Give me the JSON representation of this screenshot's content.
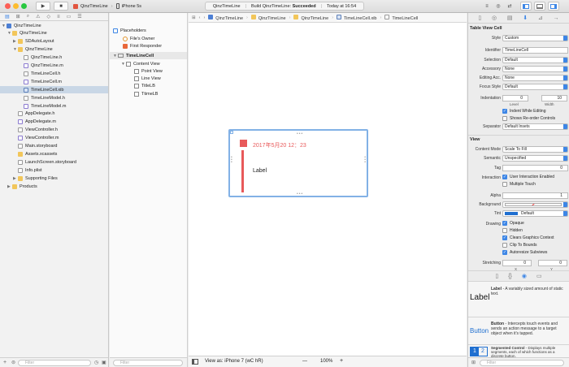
{
  "toolbar": {
    "scheme": "QinzTimeLine",
    "device": "iPhone 5s",
    "activity_project": "QinzTimeLine",
    "activity_status_prefix": "Build QinzTimeLine: ",
    "activity_status": "Succeeded",
    "activity_time": "Today at 16:54"
  },
  "navigator": {
    "rows": [
      {
        "label": "QinzTimeLine",
        "icon": "project",
        "indent": 0,
        "open": true
      },
      {
        "label": "QinzTimeLine",
        "icon": "folder",
        "indent": 1,
        "open": true
      },
      {
        "label": "SDAutoLayout",
        "icon": "folder",
        "indent": 2,
        "open": false
      },
      {
        "label": "QinzTimeLine",
        "icon": "folder",
        "indent": 2,
        "open": true
      },
      {
        "label": "QinzTimeLine.h",
        "icon": "h",
        "indent": 3
      },
      {
        "label": "QinzTimeLine.m",
        "icon": "m",
        "indent": 3
      },
      {
        "label": "TimeLineCell.h",
        "icon": "h",
        "indent": 3
      },
      {
        "label": "TimeLineCell.m",
        "icon": "m",
        "indent": 3
      },
      {
        "label": "TimeLineCell.xib",
        "icon": "xib",
        "indent": 3,
        "selected": true
      },
      {
        "label": "TimeLineModel.h",
        "icon": "h",
        "indent": 3
      },
      {
        "label": "TimeLineModel.m",
        "icon": "m",
        "indent": 3
      },
      {
        "label": "AppDelegate.h",
        "icon": "h",
        "indent": 2
      },
      {
        "label": "AppDelegate.m",
        "icon": "m",
        "indent": 2
      },
      {
        "label": "ViewController.h",
        "icon": "h",
        "indent": 2
      },
      {
        "label": "ViewController.m",
        "icon": "m",
        "indent": 2
      },
      {
        "label": "Main.storyboard",
        "icon": "storyboard",
        "indent": 2
      },
      {
        "label": "Assets.xcassets",
        "icon": "assets",
        "indent": 2
      },
      {
        "label": "LaunchScreen.storyboard",
        "icon": "storyboard",
        "indent": 2
      },
      {
        "label": "Info.plist",
        "icon": "plist",
        "indent": 2
      },
      {
        "label": "Supporting Files",
        "icon": "folder",
        "indent": 2,
        "open": false
      },
      {
        "label": "Products",
        "icon": "folder",
        "indent": 1,
        "open": false
      }
    ],
    "filter_placeholder": "Filter"
  },
  "jumpbar": [
    "QinzTimeLine",
    "QinzTimeLine",
    "QinzTimeLine",
    "TimeLineCell.xib",
    "TimeLineCell"
  ],
  "outline": {
    "placeholders_header": "Placeholders",
    "placeholders": [
      "File's Owner",
      "First Responder"
    ],
    "cell_header": "TimeLineCell",
    "items": [
      {
        "label": "Content View",
        "indent": 1
      },
      {
        "label": "Point View",
        "indent": 2
      },
      {
        "label": "Line View",
        "indent": 2
      },
      {
        "label": "TitleLB",
        "indent": 2
      },
      {
        "label": "TtimeLB",
        "indent": 2
      }
    ],
    "filter_placeholder": "Filter"
  },
  "canvas": {
    "time_text": "2017年5月20  12：23",
    "label_text": "Label",
    "accent_color": "#e8595a"
  },
  "editor_footer": {
    "view_as": "View as: iPhone 7 (wC hR)",
    "zoom_minus": "—",
    "zoom": "100%",
    "zoom_plus": "+"
  },
  "inspector": {
    "table_view_cell": {
      "header": "Table View Cell",
      "style_label": "Style",
      "style": "Custom",
      "identifier_label": "Identifier",
      "identifier": "TimeLineCell",
      "selection_label": "Selection",
      "selection": "Default",
      "accessory_label": "Accessory",
      "accessory": "None",
      "editing_acc_label": "Editing Acc.",
      "editing_acc": "None",
      "focus_style_label": "Focus Style",
      "focus_style": "Default",
      "indentation_label": "Indentation",
      "indent_level": "0",
      "indent_width": "10",
      "level_label": "Level",
      "width_label": "Width",
      "indent_while_editing": "Indent While Editing",
      "shows_reorder": "Shows Re-order Controls",
      "separator_label": "Separator",
      "separator": "Default Insets"
    },
    "view": {
      "header": "View",
      "content_mode_label": "Content Mode",
      "content_mode": "Scale To Fill",
      "semantic_label": "Semantic",
      "semantic": "Unspecified",
      "tag_label": "Tag",
      "tag": "0",
      "interaction_label": "Interaction",
      "user_interaction": "User Interaction Enabled",
      "multiple_touch": "Multiple Touch",
      "alpha_label": "Alpha",
      "alpha": "1",
      "background_label": "Background",
      "tint_label": "Tint",
      "tint": "Default",
      "drawing_label": "Drawing",
      "opaque": "Opaque",
      "hidden": "Hidden",
      "clears_graphics": "Clears Graphics Context",
      "clip_to_bounds": "Clip To Bounds",
      "autoresize": "Autoresize Subviews",
      "stretching_label": "Stretching",
      "stretch_x": "0",
      "stretch_y": "0",
      "x_label": "X",
      "y_label": "Y"
    },
    "library": [
      {
        "title": "Label",
        "desc_bold": "Label",
        "desc": " - A variably sized amount of static text."
      },
      {
        "title": "Button",
        "desc_bold": "Button",
        "desc": " - Intercepts touch events and sends an action message to a target object when it's tapped."
      },
      {
        "title": "1 2",
        "desc_bold": "Segmented Control",
        "desc": " - Displays multiple segments, each of which functions as a discrete button."
      }
    ],
    "filter_placeholder": "Filter"
  }
}
